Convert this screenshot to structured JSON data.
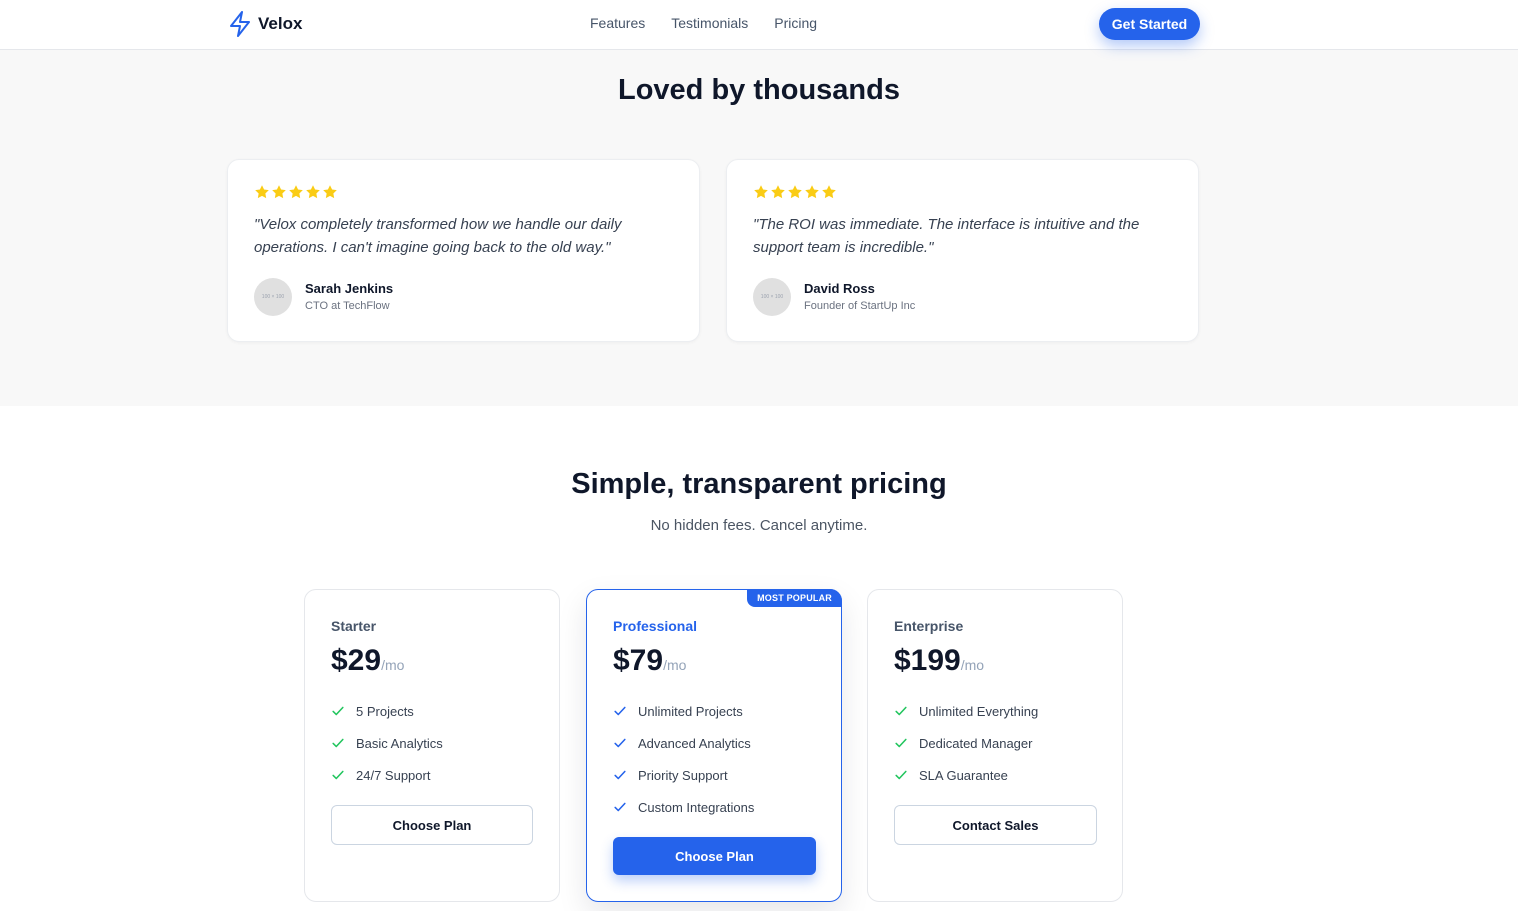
{
  "nav": {
    "brand": "Velox",
    "links": [
      "Features",
      "Testimonials",
      "Pricing"
    ],
    "cta": "Get Started"
  },
  "testimonials": {
    "title": "Loved by thousands",
    "items": [
      {
        "rating": 5,
        "quote": "\"Velox completely transformed how we handle our daily operations. I can't imagine going back to the old way.\"",
        "avatar_text": "100 × 100",
        "name": "Sarah Jenkins",
        "role": "CTO at TechFlow"
      },
      {
        "rating": 5,
        "quote": "\"The ROI was immediate. The interface is intuitive and the support team is incredible.\"",
        "avatar_text": "100 × 100",
        "name": "David Ross",
        "role": "Founder of StartUp Inc"
      }
    ]
  },
  "pricing": {
    "title": "Simple, transparent pricing",
    "subtitle": "No hidden fees. Cancel anytime.",
    "plans": [
      {
        "name": "Starter",
        "price": "$29",
        "period": "/mo",
        "features": [
          "5 Projects",
          "Basic Analytics",
          "24/7 Support"
        ],
        "button": "Choose Plan"
      },
      {
        "name": "Professional",
        "badge": "MOST POPULAR",
        "price": "$79",
        "period": "/mo",
        "features": [
          "Unlimited Projects",
          "Advanced Analytics",
          "Priority Support",
          "Custom Integrations"
        ],
        "button": "Choose Plan"
      },
      {
        "name": "Enterprise",
        "price": "$199",
        "period": "/mo",
        "features": [
          "Unlimited Everything",
          "Dedicated Manager",
          "SLA Guarantee"
        ],
        "button": "Contact Sales"
      }
    ]
  },
  "colors": {
    "accent": "#2563eb",
    "star": "#facc15",
    "check_green": "#22c55e",
    "check_blue": "#2563eb"
  },
  "icons": {
    "logo": "lightning-bolt-icon",
    "star": "star-icon",
    "check": "check-icon"
  }
}
